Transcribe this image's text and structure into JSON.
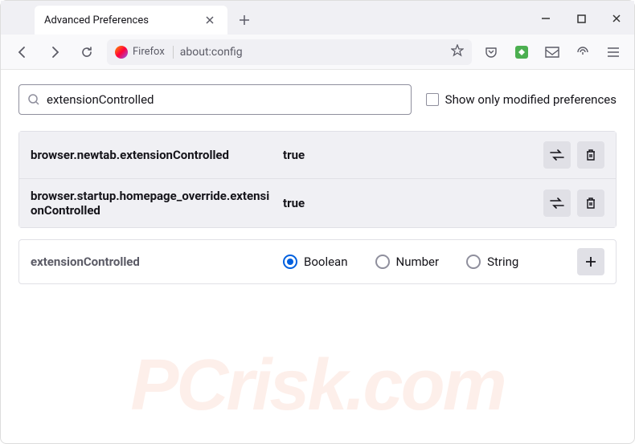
{
  "tab": {
    "title": "Advanced Preferences"
  },
  "urlbar": {
    "identity": "Firefox",
    "url": "about:config"
  },
  "search": {
    "value": "extensionControlled",
    "checkbox_label": "Show only modified preferences"
  },
  "prefs": [
    {
      "name": "browser.newtab.extensionControlled",
      "value": "true"
    },
    {
      "name": "browser.startup.homepage_override.extensionControlled",
      "value": "true"
    }
  ],
  "new_pref": {
    "name": "extensionControlled",
    "types": [
      "Boolean",
      "Number",
      "String"
    ],
    "selected": "Boolean"
  },
  "watermark": "PCrisk.com"
}
